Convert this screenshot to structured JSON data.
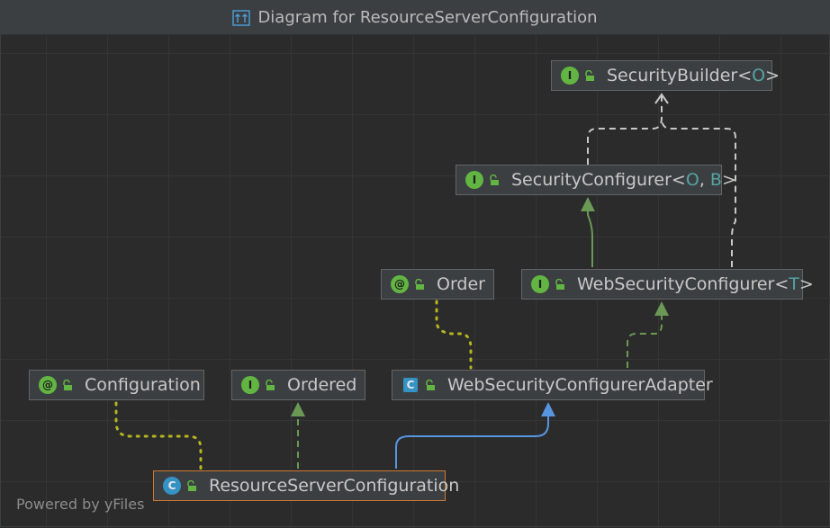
{
  "window": {
    "title": "Diagram for ResourceServerConfiguration"
  },
  "footer": {
    "text": "Powered by yFiles"
  },
  "colors": {
    "background": "#2b2b2b",
    "node_fill": "#3c3f41",
    "node_border": "#646464",
    "selected_border": "#cc7832",
    "interface_badge": "#62b543",
    "class_badge": "#3592c4",
    "implements_edge": "#6a9955",
    "extends_edge": "#5895e0",
    "annotation_edge": "#b5b522",
    "type_param": "#55a3a3"
  },
  "nodes": {
    "security_builder": {
      "badge": "I",
      "kind": "interface",
      "name": "SecurityBuilder",
      "lt": "<",
      "params": "O",
      "gt": ">"
    },
    "security_configurer": {
      "badge": "I",
      "kind": "interface",
      "name": "SecurityConfigurer",
      "lt": "<",
      "param1": "O",
      "sep": ", ",
      "param2": "B",
      "gt": ">"
    },
    "order": {
      "badge": "@",
      "kind": "annotation",
      "name": "Order"
    },
    "web_security_configurer": {
      "badge": "I",
      "kind": "interface",
      "name": "WebSecurityConfigurer",
      "lt": "<",
      "params": "T",
      "gt": ">"
    },
    "configuration": {
      "badge": "@",
      "kind": "annotation",
      "name": "Configuration"
    },
    "ordered": {
      "badge": "I",
      "kind": "interface",
      "name": "Ordered"
    },
    "web_security_configurer_adapter": {
      "badge": "C",
      "kind": "abstract-class",
      "name": "WebSecurityConfigurerAdapter"
    },
    "resource_server_configuration": {
      "badge": "C",
      "kind": "class",
      "name": "ResourceServerConfiguration",
      "selected": true
    }
  },
  "edges": [
    {
      "from": "SecurityConfigurer",
      "to": "SecurityBuilder",
      "type": "dependency"
    },
    {
      "from": "WebSecurityConfigurer",
      "to": "SecurityBuilder",
      "type": "dependency"
    },
    {
      "from": "WebSecurityConfigurer",
      "to": "SecurityConfigurer",
      "type": "extends-interface"
    },
    {
      "from": "WebSecurityConfigurerAdapter",
      "to": "WebSecurityConfigurer",
      "type": "implements"
    },
    {
      "from": "WebSecurityConfigurerAdapter",
      "to": "Order",
      "type": "annotated-with"
    },
    {
      "from": "ResourceServerConfiguration",
      "to": "Configuration",
      "type": "annotated-with"
    },
    {
      "from": "ResourceServerConfiguration",
      "to": "Ordered",
      "type": "implements"
    },
    {
      "from": "ResourceServerConfiguration",
      "to": "WebSecurityConfigurerAdapter",
      "type": "extends"
    }
  ]
}
